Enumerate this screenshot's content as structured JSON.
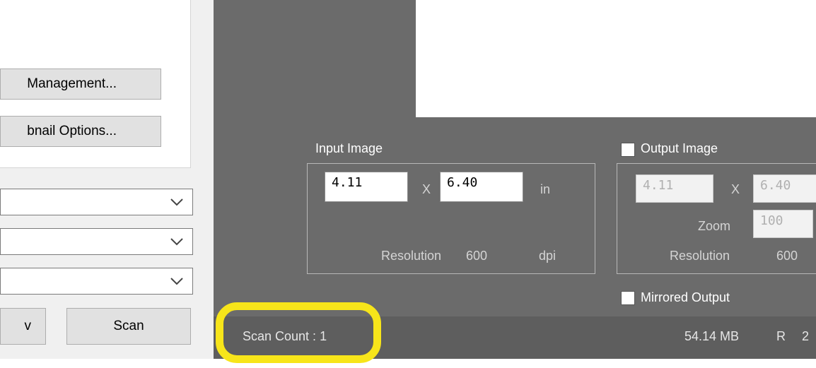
{
  "left_panel": {
    "management_button": "Management...",
    "thumbnail_button": "bnail Options...",
    "preview_button_fragment": "v",
    "scan_button": "Scan"
  },
  "input_image": {
    "label": "Input Image",
    "width": "4.11",
    "x_sep": "X",
    "height": "6.40",
    "unit": "in",
    "resolution_label": "Resolution",
    "resolution_value": "600",
    "resolution_unit": "dpi"
  },
  "output_image": {
    "label": "Output Image",
    "width": "4.11",
    "x_sep": "X",
    "height": "6.40",
    "zoom_label": "Zoom",
    "zoom_value": "100",
    "resolution_label": "Resolution",
    "resolution_value": "600",
    "mirrored_label": "Mirrored Output"
  },
  "status_bar": {
    "scan_count": "Scan Count : 1",
    "memory": "54.14 MB",
    "channel": "R",
    "channel_value_fragment": "2"
  },
  "colors": {
    "panel_bg": "#6b6b6b",
    "status_bg": "#5e5e5e",
    "highlight": "#f7e51a"
  }
}
